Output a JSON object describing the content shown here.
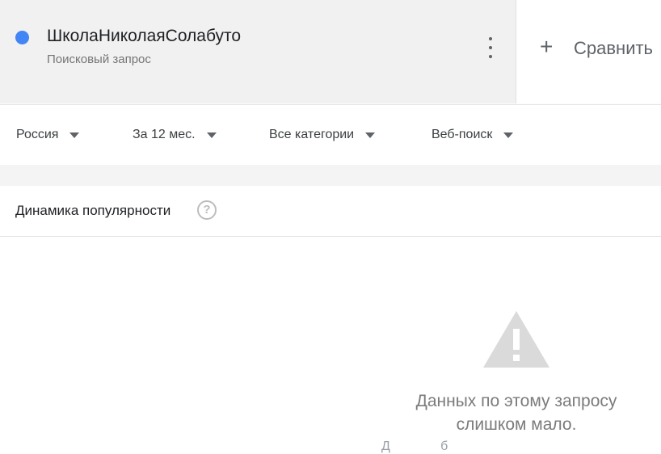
{
  "term": {
    "title": "ШколаНиколаяСолабуто",
    "subtitle": "Поисковый запрос",
    "dot_color": "#4285f4"
  },
  "compare": {
    "label": "Сравнить",
    "icon": "plus-icon"
  },
  "filters": [
    {
      "label": "Россия"
    },
    {
      "label": "За 12 мес."
    },
    {
      "label": "Все категории"
    },
    {
      "label": "Веб-поиск"
    }
  ],
  "section": {
    "title": "Динамика популярности",
    "help_icon": "question-icon"
  },
  "empty_state": {
    "icon": "warning-icon",
    "line1": "Данных по этому запросу",
    "line2": "слишком мало.",
    "line3": "Д              б"
  }
}
